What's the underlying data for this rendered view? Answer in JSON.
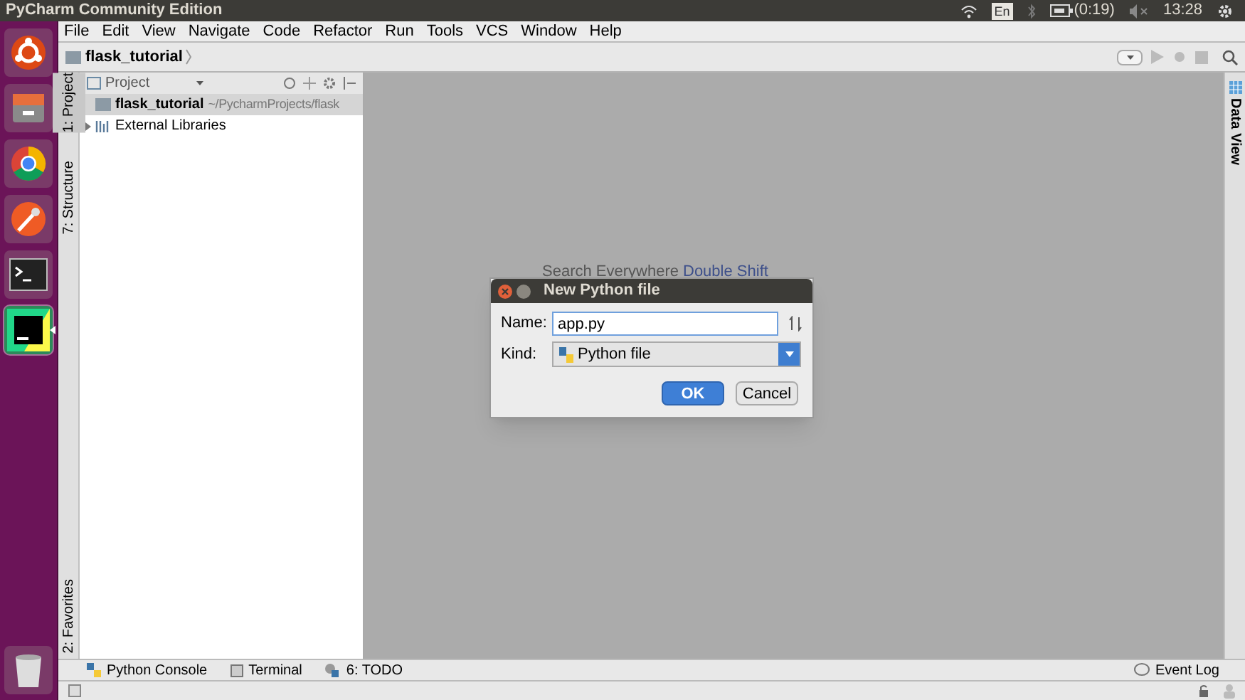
{
  "top_bar": {
    "title": "PyCharm Community Edition",
    "keyboard_layout": "En",
    "battery_time": "(0:19)",
    "clock": "13:28"
  },
  "launcher": {
    "items": [
      {
        "kind": "ubuntu",
        "selected": false
      },
      {
        "kind": "files",
        "selected": false
      },
      {
        "kind": "browser",
        "selected": false
      },
      {
        "kind": "postman",
        "selected": false
      },
      {
        "kind": "terminal",
        "selected": false
      },
      {
        "kind": "pycharm",
        "selected": true
      }
    ]
  },
  "menu_bar": [
    "File",
    "Edit",
    "View",
    "Navigate",
    "Code",
    "Refactor",
    "Run",
    "Tools",
    "VCS",
    "Window",
    "Help"
  ],
  "breadcrumb": "flask_tutorial",
  "left_tool_strip": [
    {
      "label": "1: Project",
      "selected": true
    },
    {
      "label": "7: Structure",
      "selected": false
    },
    {
      "label": "2: Favorites",
      "selected": false
    }
  ],
  "project_panel": {
    "header": "Project",
    "tree": [
      {
        "name": "flask_tutorial",
        "path": "~/PycharmProjects/flask",
        "expanded": false,
        "kind": "folder"
      },
      {
        "name": "External Libraries",
        "expanded": false,
        "kind": "library"
      }
    ]
  },
  "editor_hint": {
    "text": "Search Everywhere",
    "shortcut": "Double Shift"
  },
  "right_tool_strip": [
    {
      "label": "Data View"
    }
  ],
  "dialog": {
    "title": "New Python file",
    "name_label": "Name:",
    "name_value": "app.py",
    "kind_label": "Kind:",
    "kind_value": "Python file",
    "buttons": [
      {
        "label": "OK",
        "default": true
      },
      {
        "label": "Cancel",
        "default": false
      }
    ]
  },
  "bottom_tools": [
    {
      "label": "Python Console",
      "kind": "python"
    },
    {
      "label": "Terminal",
      "kind": "terminal"
    },
    {
      "label": "6: TODO",
      "kind": "todo"
    }
  ],
  "event_log": "Event Log"
}
